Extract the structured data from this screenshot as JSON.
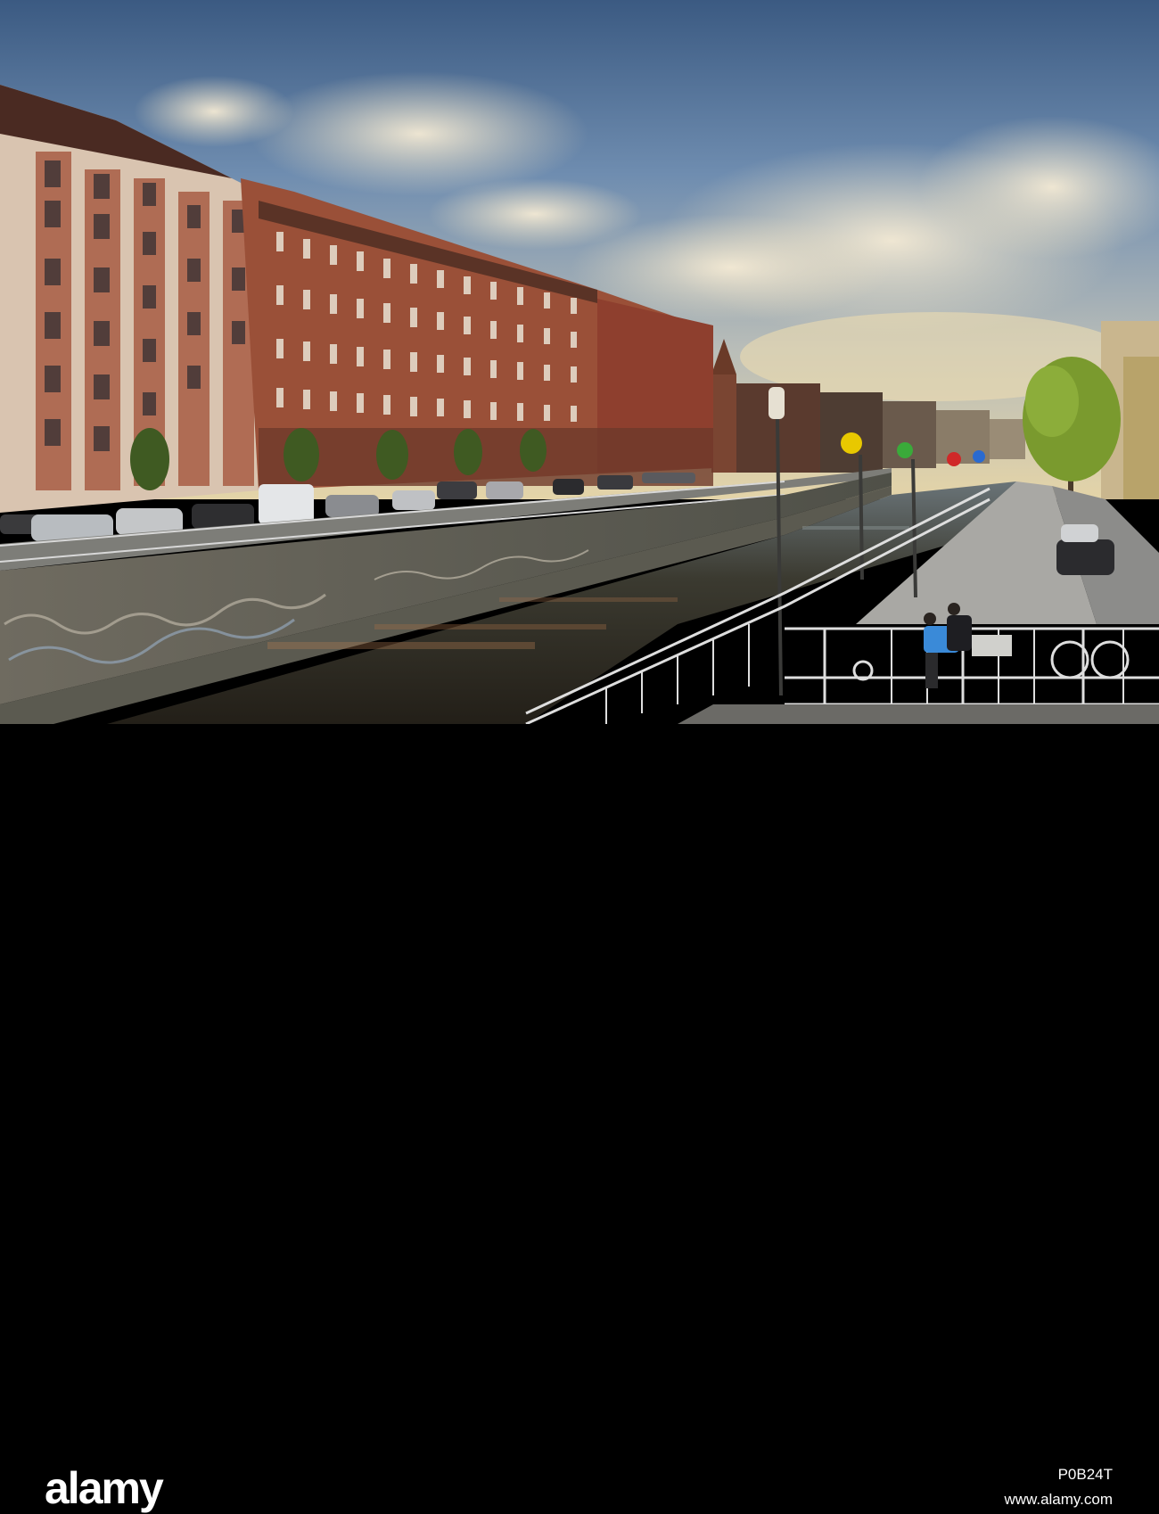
{
  "watermark": {
    "brand": "alamy",
    "image_id": "P0B24T",
    "site_url": "www.alamy.com"
  },
  "scene": {
    "sky_colors": [
      "#3e5c80",
      "#7f9ab4",
      "#c9c9bf",
      "#e5d6ae"
    ],
    "building_colors": [
      "#8e4a33",
      "#a4573b",
      "#b9806a",
      "#e6d2bf"
    ],
    "water_color": "#2a2a22",
    "railing_color": "#dcdcdc",
    "tree_color": "#7a9a2e"
  }
}
